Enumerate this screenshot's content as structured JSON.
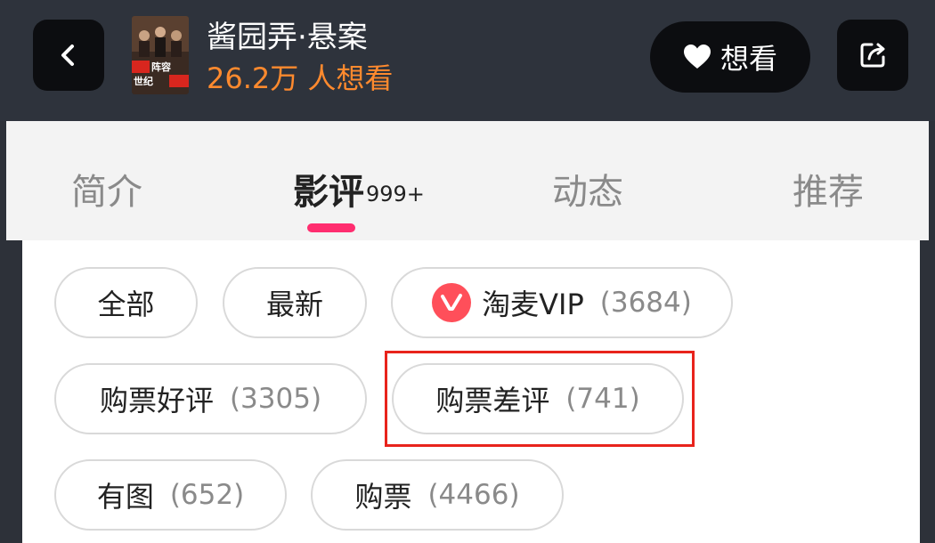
{
  "header": {
    "back_icon": "chevron-left-icon",
    "movie_title": "酱园弄·悬案",
    "want_count": "26.2万 人想看",
    "want_button_label": "想看",
    "want_icon": "heart-icon",
    "share_icon": "share-icon",
    "poster_text_lines": [
      "阵容",
      "世纪"
    ]
  },
  "tabs": [
    {
      "label": "简介"
    },
    {
      "label": "影评",
      "badge": "999+"
    },
    {
      "label": "动态"
    },
    {
      "label": "推荐"
    }
  ],
  "filters": [
    {
      "label": "全部",
      "count": ""
    },
    {
      "label": "最新",
      "count": ""
    },
    {
      "label": "淘麦VIP",
      "count": "(3684)"
    },
    {
      "label": "购票好评",
      "count": "(3305)"
    },
    {
      "label": "购票差评",
      "count": "(741)"
    },
    {
      "label": "有图",
      "count": "(652)"
    },
    {
      "label": "购票",
      "count": "(4466)"
    }
  ],
  "colors": {
    "header_bg": "#2e333c",
    "accent_orange": "#ff8a2e",
    "tab_underline": "#ff2d6f",
    "highlight_red": "#e8231c"
  }
}
